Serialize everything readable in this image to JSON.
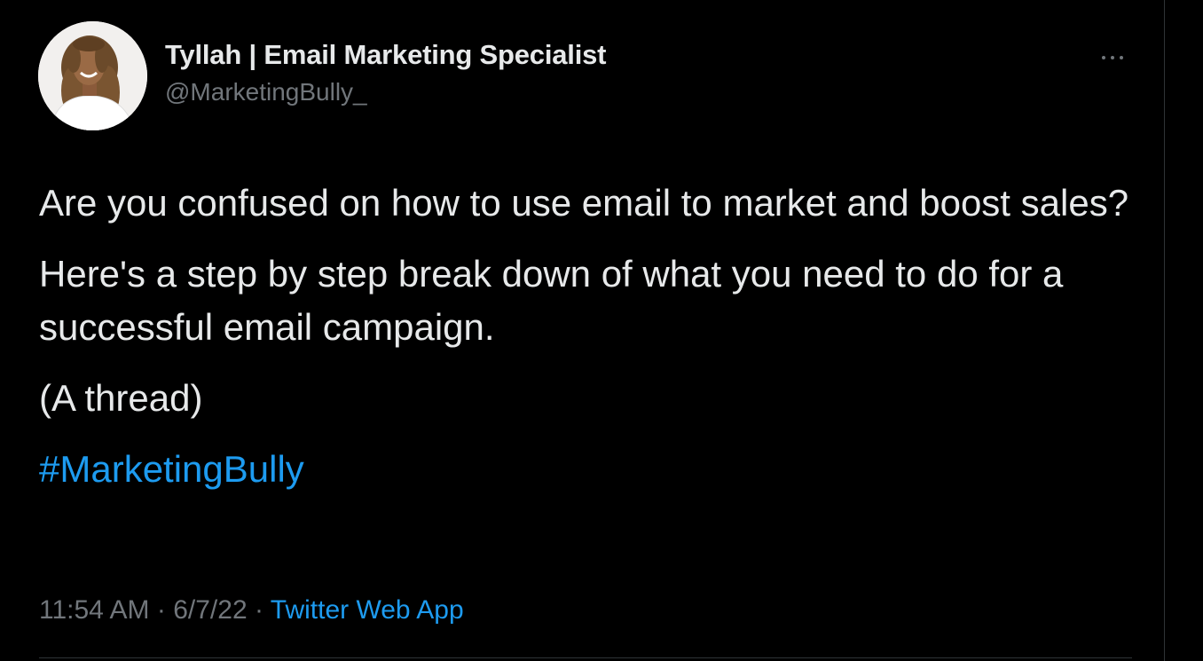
{
  "author": {
    "display_name": "Tyllah | Email Marketing Specialist",
    "handle": "@MarketingBully_",
    "avatar_icon": "profile-photo"
  },
  "more_menu": {
    "icon": "more-horizontal-icon",
    "glyph": "···"
  },
  "tweet": {
    "paragraphs": [
      "Are you confused on how to use email to market and boost sales?",
      "Here's a step by step break down of what you need to do for a successful email campaign.",
      "(A thread)"
    ],
    "hashtag": "#MarketingBully"
  },
  "meta": {
    "time": "11:54 AM",
    "separator": "·",
    "date": "6/7/22",
    "source": "Twitter Web App"
  },
  "colors": {
    "background": "#000000",
    "text_primary": "#e7e9ea",
    "text_secondary": "#71767b",
    "accent": "#1d9bf0"
  }
}
